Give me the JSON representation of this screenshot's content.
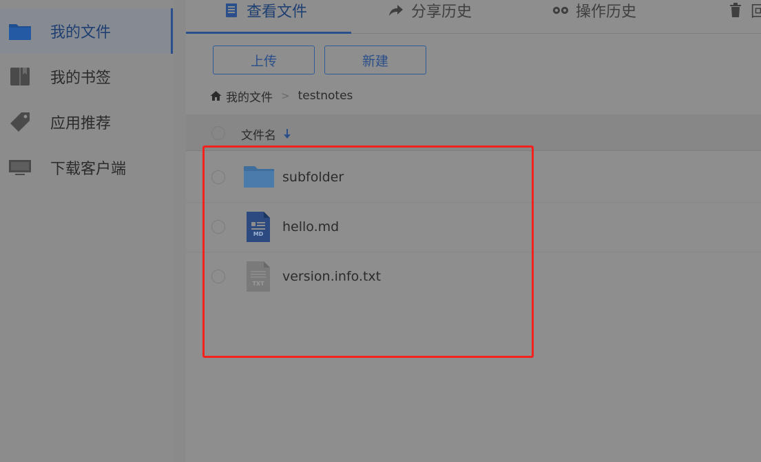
{
  "sidebar": {
    "items": [
      {
        "label": "我的文件",
        "icon": "folder-icon"
      },
      {
        "label": "我的书签",
        "icon": "book-icon"
      },
      {
        "label": "应用推荐",
        "icon": "tag-icon"
      },
      {
        "label": "下载客户端",
        "icon": "monitor-icon"
      }
    ]
  },
  "tabs": [
    {
      "label": "查看文件",
      "icon": "document-icon"
    },
    {
      "label": "分享历史",
      "icon": "share-arrow-icon"
    },
    {
      "label": "操作历史",
      "icon": "history-icon"
    },
    {
      "label": "回",
      "icon": "trash-icon"
    }
  ],
  "toolbar": {
    "upload_label": "上传",
    "new_label": "新建"
  },
  "breadcrumb": {
    "root": "我的文件",
    "separator": ">",
    "current": "testnotes"
  },
  "list": {
    "header_label": "文件名",
    "sort": "descending",
    "rows": [
      {
        "name": "subfolder",
        "type": "folder"
      },
      {
        "name": "hello.md",
        "type": "md",
        "badge": "MD"
      },
      {
        "name": "version.info.txt",
        "type": "txt",
        "badge": "TXT"
      }
    ]
  },
  "colors": {
    "accent": "#2a4f8a",
    "highlight_box": "#f4211c"
  }
}
